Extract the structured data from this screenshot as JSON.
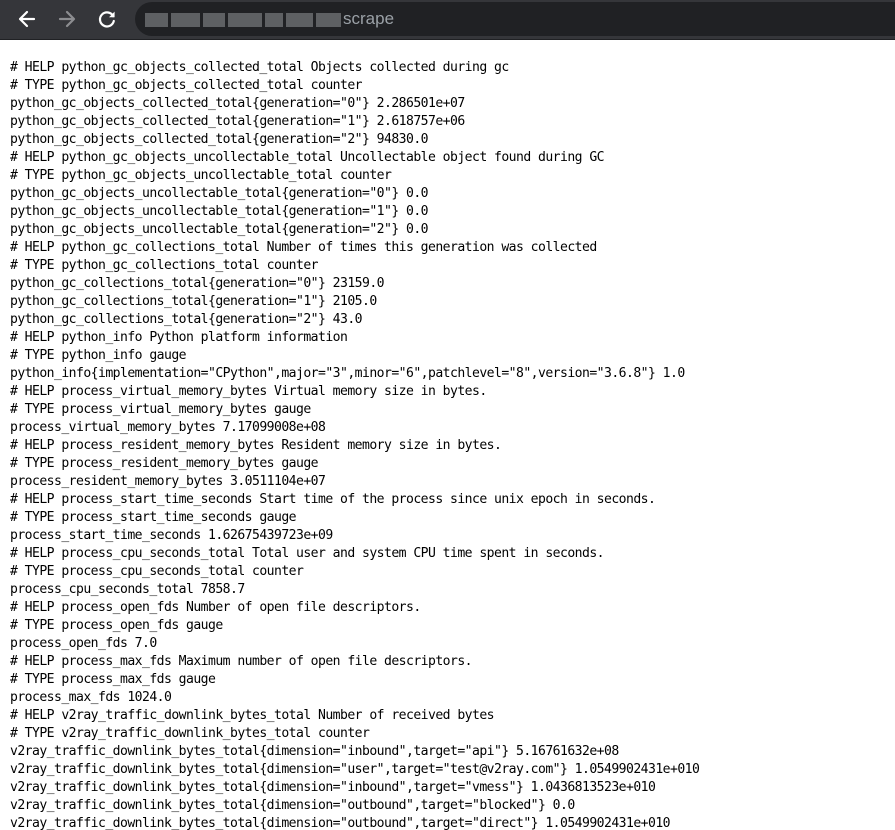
{
  "browser": {
    "url_visible_suffix": "scrape",
    "icons": {
      "back": "arrow-left-icon",
      "forward": "arrow-right-icon",
      "reload": "reload-icon"
    },
    "colors": {
      "toolbar": "#35363a",
      "omnibox": "#202124",
      "icon": "#ffffff",
      "icon_disabled": "#8c8d90",
      "url_text": "#9aa0a6"
    }
  },
  "page": {
    "lines": [
      "# HELP python_gc_objects_collected_total Objects collected during gc",
      "# TYPE python_gc_objects_collected_total counter",
      "python_gc_objects_collected_total{generation=\"0\"} 2.286501e+07",
      "python_gc_objects_collected_total{generation=\"1\"} 2.618757e+06",
      "python_gc_objects_collected_total{generation=\"2\"} 94830.0",
      "# HELP python_gc_objects_uncollectable_total Uncollectable object found during GC",
      "# TYPE python_gc_objects_uncollectable_total counter",
      "python_gc_objects_uncollectable_total{generation=\"0\"} 0.0",
      "python_gc_objects_uncollectable_total{generation=\"1\"} 0.0",
      "python_gc_objects_uncollectable_total{generation=\"2\"} 0.0",
      "# HELP python_gc_collections_total Number of times this generation was collected",
      "# TYPE python_gc_collections_total counter",
      "python_gc_collections_total{generation=\"0\"} 23159.0",
      "python_gc_collections_total{generation=\"1\"} 2105.0",
      "python_gc_collections_total{generation=\"2\"} 43.0",
      "# HELP python_info Python platform information",
      "# TYPE python_info gauge",
      "python_info{implementation=\"CPython\",major=\"3\",minor=\"6\",patchlevel=\"8\",version=\"3.6.8\"} 1.0",
      "# HELP process_virtual_memory_bytes Virtual memory size in bytes.",
      "# TYPE process_virtual_memory_bytes gauge",
      "process_virtual_memory_bytes 7.17099008e+08",
      "# HELP process_resident_memory_bytes Resident memory size in bytes.",
      "# TYPE process_resident_memory_bytes gauge",
      "process_resident_memory_bytes 3.0511104e+07",
      "# HELP process_start_time_seconds Start time of the process since unix epoch in seconds.",
      "# TYPE process_start_time_seconds gauge",
      "process_start_time_seconds 1.62675439723e+09",
      "# HELP process_cpu_seconds_total Total user and system CPU time spent in seconds.",
      "# TYPE process_cpu_seconds_total counter",
      "process_cpu_seconds_total 7858.7",
      "# HELP process_open_fds Number of open file descriptors.",
      "# TYPE process_open_fds gauge",
      "process_open_fds 7.0",
      "# HELP process_max_fds Maximum number of open file descriptors.",
      "# TYPE process_max_fds gauge",
      "process_max_fds 1024.0",
      "# HELP v2ray_traffic_downlink_bytes_total Number of received bytes",
      "# TYPE v2ray_traffic_downlink_bytes_total counter",
      "v2ray_traffic_downlink_bytes_total{dimension=\"inbound\",target=\"api\"} 5.16761632e+08",
      "v2ray_traffic_downlink_bytes_total{dimension=\"user\",target=\"test@v2ray.com\"} 1.0549902431e+010",
      "v2ray_traffic_downlink_bytes_total{dimension=\"inbound\",target=\"vmess\"} 1.0436813523e+010",
      "v2ray_traffic_downlink_bytes_total{dimension=\"outbound\",target=\"blocked\"} 0.0",
      "v2ray_traffic_downlink_bytes_total{dimension=\"outbound\",target=\"direct\"} 1.0549902431e+010"
    ]
  }
}
